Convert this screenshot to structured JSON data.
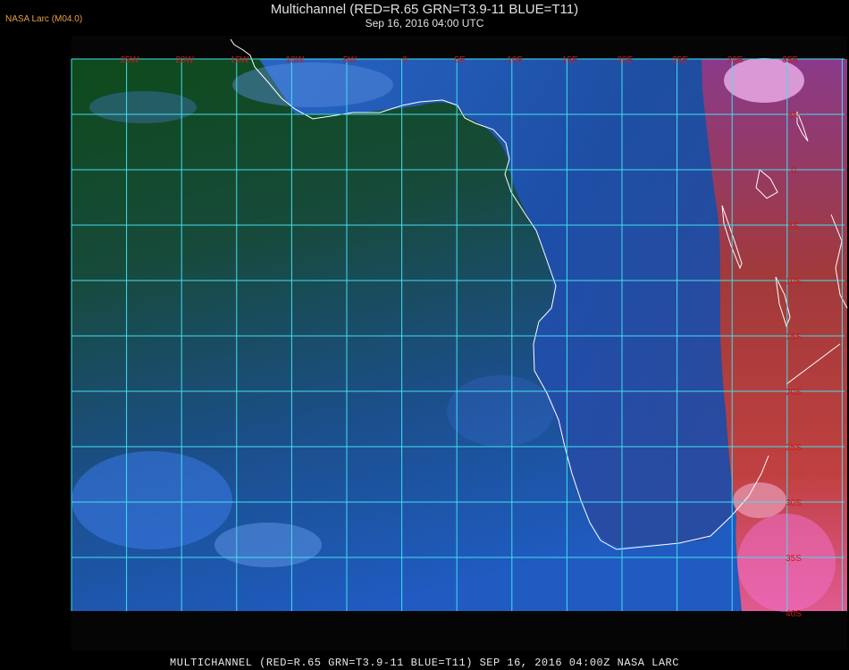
{
  "credit": "NASA Larc (M04.0)",
  "title": "Multichannel (RED=R.65 GRN=T3.9-11 BLUE=T11)",
  "subtitle": "Sep 16, 2016 04:00 UTC",
  "footer": "MULTICHANNEL (RED=R.65 GRN=T3.9-11 BLUE=T11) SEP 16, 2016 04:00Z   NASA LARC",
  "colors": {
    "grid": "#40e0f0",
    "label": "#d01818",
    "coast": "#ffffff",
    "ocean_green": "#0d4a1c",
    "ocean_blue": "#1f56b0",
    "land_red": "#c03838",
    "land_pink": "#e060b0"
  },
  "longitude_labels": [
    "25W",
    "20W",
    "15W",
    "10W",
    "5W",
    "0",
    "5E",
    "10E",
    "15E",
    "20E",
    "25E",
    "30E",
    "35E"
  ],
  "latitude_labels": [
    "5N",
    "0",
    "5S",
    "10S",
    "15S",
    "20S",
    "25S",
    "30S",
    "35S",
    "40S"
  ]
}
